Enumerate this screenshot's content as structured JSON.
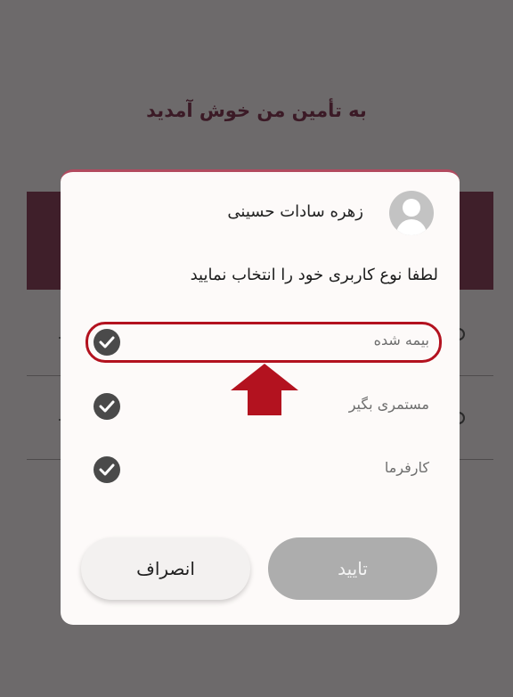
{
  "background": {
    "title": "به تأمین من خوش آمدید"
  },
  "dialog": {
    "user_name": "زهره سادات حسینی",
    "prompt": "لطفا نوع کاربری خود را انتخاب نمایید",
    "options": [
      {
        "label": "بیمه شده",
        "selected": true,
        "icon": "check-circle-icon"
      },
      {
        "label": "مستمری بگیر",
        "selected": false,
        "icon": "check-circle-icon"
      },
      {
        "label": "کارفرما",
        "selected": false,
        "icon": "check-circle-icon"
      }
    ],
    "cancel_label": "انصراف",
    "confirm_label": "تایید"
  },
  "colors": {
    "highlight": "#b3121f",
    "overlay": "#6d6a6b",
    "header_card": "#3f1f2a"
  }
}
